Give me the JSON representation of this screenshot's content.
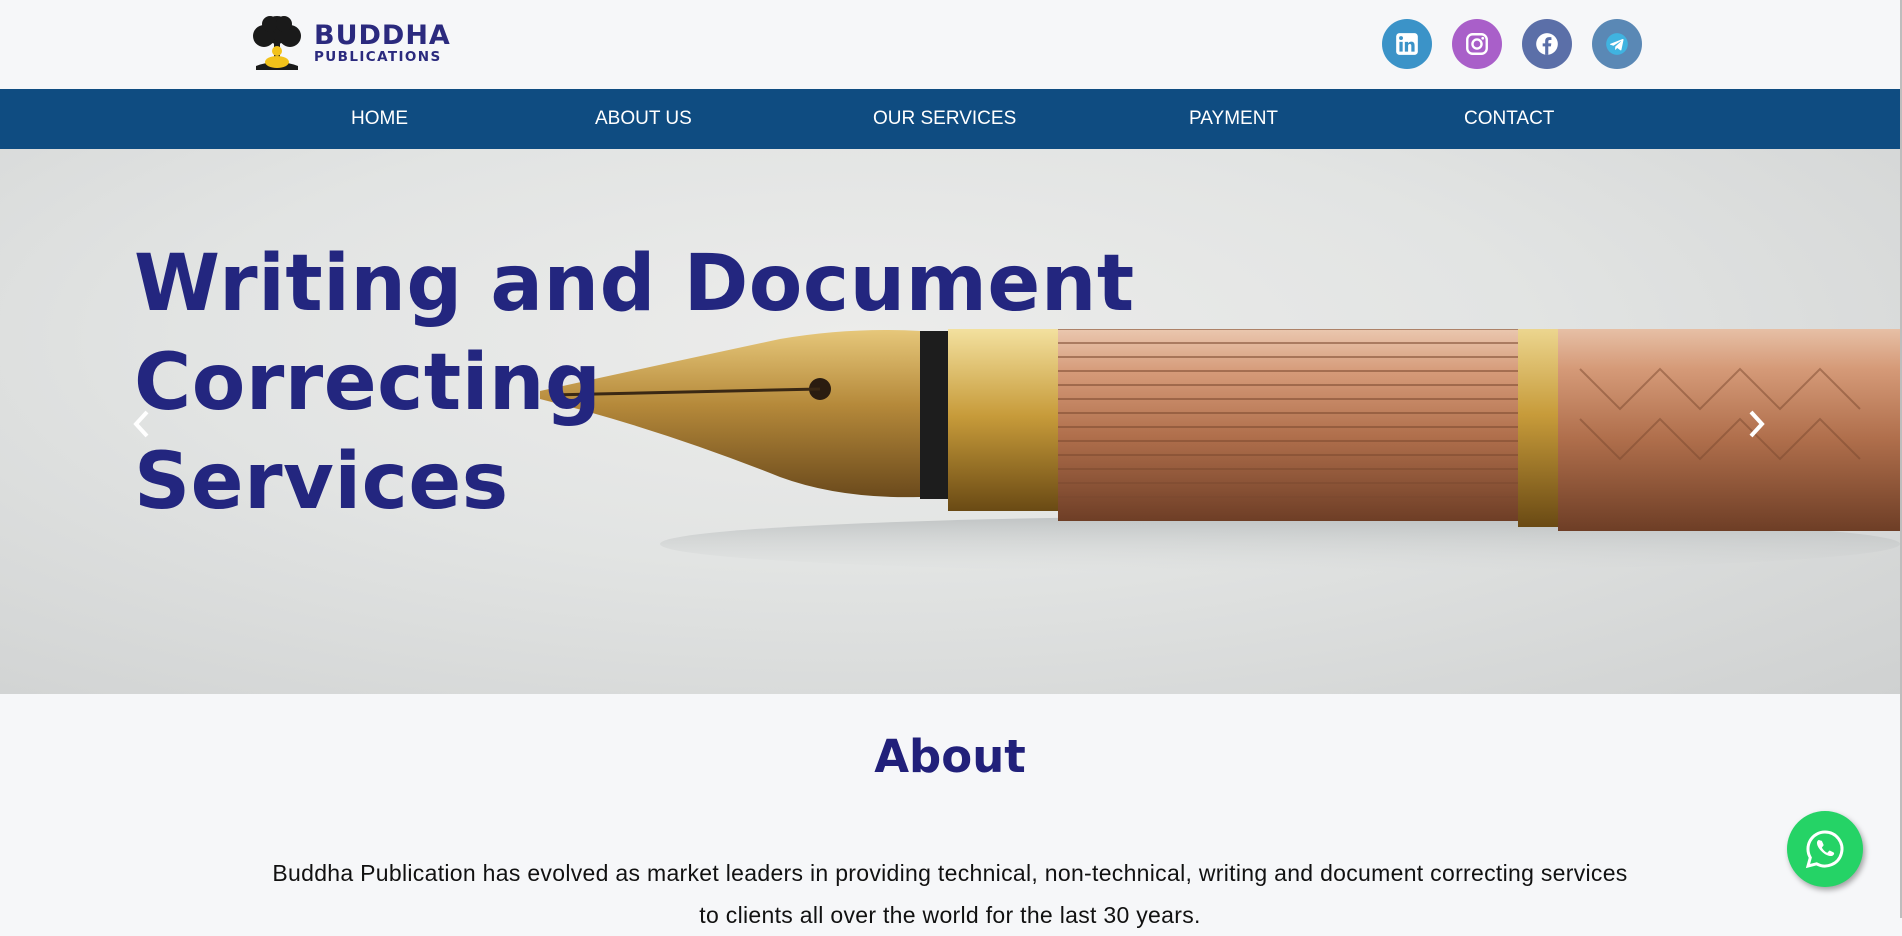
{
  "header": {
    "logo": {
      "title": "BUDDHA",
      "subtitle": "PUBLICATIONS",
      "icon": "tree-buddha-logo-icon"
    },
    "social": [
      {
        "name": "LinkedIn",
        "icon": "linkedin-icon",
        "color": "#3b93c8"
      },
      {
        "name": "Instagram",
        "icon": "instagram-icon",
        "color": "#a95fc9"
      },
      {
        "name": "Facebook",
        "icon": "facebook-icon",
        "color": "#5b6fa8"
      },
      {
        "name": "Telegram",
        "icon": "telegram-icon",
        "color": "#5a88b5"
      }
    ]
  },
  "nav": {
    "items": [
      {
        "label": "HOME"
      },
      {
        "label": "ABOUT US"
      },
      {
        "label": "OUR SERVICES"
      },
      {
        "label": "PAYMENT"
      },
      {
        "label": "CONTACT"
      }
    ],
    "background": "#0f4c81"
  },
  "hero": {
    "lines": [
      "Writing and Document",
      "Correcting",
      "Services"
    ],
    "prev_icon": "chevron-left-icon",
    "next_icon": "chevron-right-icon"
  },
  "about": {
    "heading": "About",
    "text": "Buddha Publication has evolved as market leaders in providing technical, non-technical, writing and document correcting services to clients all over the world for the last 30 years."
  },
  "whatsapp": {
    "icon": "whatsapp-icon",
    "color": "#25d366"
  }
}
